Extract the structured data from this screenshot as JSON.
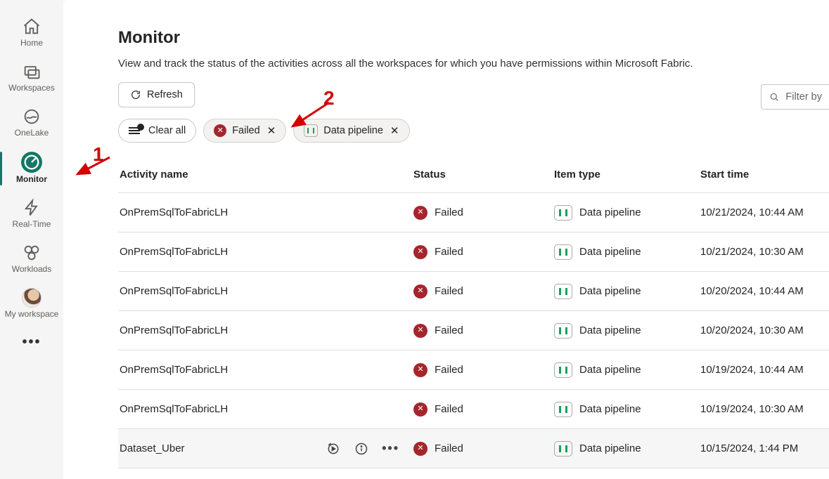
{
  "sidebar": {
    "items": [
      {
        "label": "Home",
        "icon": "home-icon",
        "selected": false
      },
      {
        "label": "Workspaces",
        "icon": "workspaces-icon",
        "selected": false
      },
      {
        "label": "OneLake",
        "icon": "onelake-icon",
        "selected": false
      },
      {
        "label": "Monitor",
        "icon": "monitor-icon",
        "selected": true
      },
      {
        "label": "Real-Time",
        "icon": "realtime-icon",
        "selected": false
      },
      {
        "label": "Workloads",
        "icon": "workloads-icon",
        "selected": false
      },
      {
        "label": "My workspace",
        "icon": "avatar-icon",
        "selected": false
      }
    ]
  },
  "page": {
    "title": "Monitor",
    "subtitle": "View and track the status of the activities across all the workspaces for which you have permissions within Microsoft Fabric."
  },
  "toolbar": {
    "refresh_label": "Refresh",
    "filter_placeholder": "Filter by"
  },
  "chips": {
    "clear_all_label": "Clear all",
    "failed_label": "Failed",
    "data_pipeline_label": "Data pipeline"
  },
  "columns": {
    "activity_name": "Activity name",
    "status": "Status",
    "item_type": "Item type",
    "start_time": "Start time"
  },
  "status_labels": {
    "failed": "Failed"
  },
  "item_types": {
    "data_pipeline": "Data pipeline"
  },
  "rows": [
    {
      "name": "OnPremSqlToFabricLH",
      "status": "Failed",
      "item_type": "Data pipeline",
      "start_time": "10/21/2024, 10:44 AM"
    },
    {
      "name": "OnPremSqlToFabricLH",
      "status": "Failed",
      "item_type": "Data pipeline",
      "start_time": "10/21/2024, 10:30 AM"
    },
    {
      "name": "OnPremSqlToFabricLH",
      "status": "Failed",
      "item_type": "Data pipeline",
      "start_time": "10/20/2024, 10:44 AM"
    },
    {
      "name": "OnPremSqlToFabricLH",
      "status": "Failed",
      "item_type": "Data pipeline",
      "start_time": "10/20/2024, 10:30 AM"
    },
    {
      "name": "OnPremSqlToFabricLH",
      "status": "Failed",
      "item_type": "Data pipeline",
      "start_time": "10/19/2024, 10:44 AM"
    },
    {
      "name": "OnPremSqlToFabricLH",
      "status": "Failed",
      "item_type": "Data pipeline",
      "start_time": "10/19/2024, 10:30 AM"
    },
    {
      "name": "Dataset_Uber",
      "status": "Failed",
      "item_type": "Data pipeline",
      "start_time": "10/15/2024, 1:44 PM",
      "hover": true
    }
  ],
  "annotations": {
    "one": "1",
    "two": "2"
  }
}
